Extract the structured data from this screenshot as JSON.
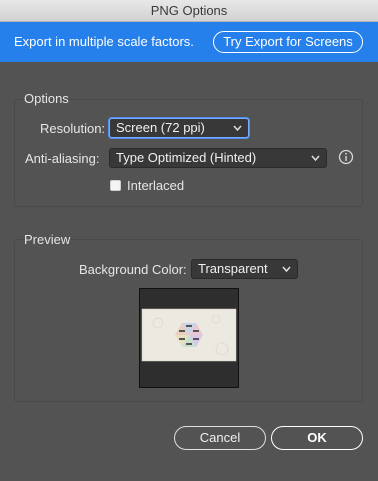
{
  "window": {
    "title": "PNG Options"
  },
  "banner": {
    "message": "Export in multiple scale factors.",
    "button_label": "Try Export for Screens"
  },
  "options": {
    "group_label": "Options",
    "resolution_label": "Resolution:",
    "resolution_value": "Screen (72 ppi)",
    "antialiasing_label": "Anti-aliasing:",
    "antialiasing_value": "Type Optimized (Hinted)",
    "interlaced_label": "Interlaced",
    "interlaced_checked": false
  },
  "preview": {
    "group_label": "Preview",
    "background_label": "Background Color:",
    "background_value": "Transparent"
  },
  "buttons": {
    "cancel": "Cancel",
    "ok": "OK"
  },
  "colors": {
    "banner": "#2680eb",
    "panel": "#535353",
    "focus": "#4b8ff0"
  }
}
